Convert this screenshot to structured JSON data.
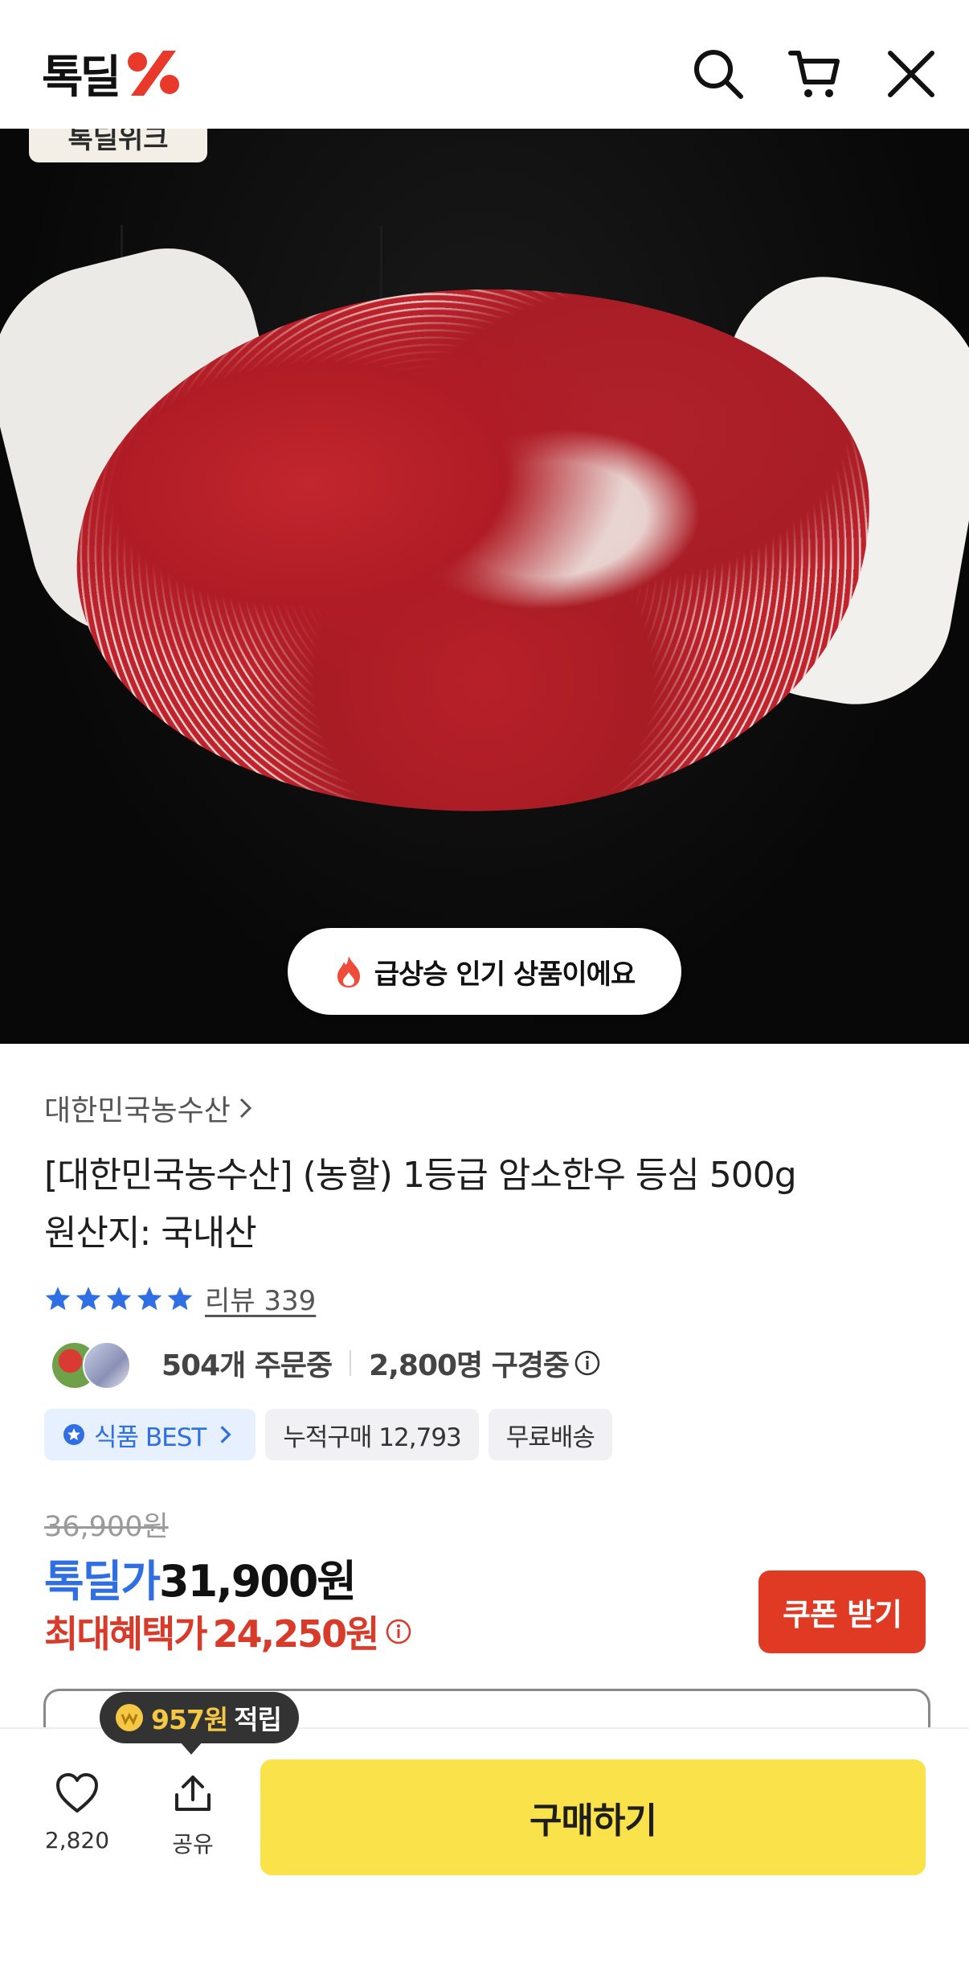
{
  "header": {
    "logo_text": "톡딜",
    "logo_accent_color": "#e8392b",
    "icons": [
      "search-icon",
      "cart-icon",
      "close-icon"
    ]
  },
  "hero": {
    "corner_badge": "톡딜위크",
    "hot_label": "급상승 인기 상품이에요"
  },
  "product": {
    "brand": "대한민국농수산",
    "title_line1": "[대한민국농수산] (농할) 1등급 암소한우 등심 500g",
    "title_line2": "원산지: 국내산",
    "rating_stars": 5,
    "review_link": "리뷰 339",
    "orders_text": "504개 주문중",
    "viewers_text": "2,800명 구경중",
    "tags": [
      "식품 BEST",
      "누적구매 12,793",
      "무료배송"
    ]
  },
  "price": {
    "original": "36,900원",
    "deal_label": "톡딜가",
    "deal_value": "31,900원",
    "max_label": "최대혜택가",
    "max_value": "24,250원",
    "coupon_button": "쿠폰 받기"
  },
  "reward_tooltip": {
    "amount": "957원",
    "word": "적립"
  },
  "bottom_bar": {
    "like_count": "2,820",
    "share_label": "공유",
    "buy_label": "구매하기"
  },
  "colors": {
    "accent_blue": "#2f6fe3",
    "sale_red": "#d83b2a",
    "buy_yellow": "#f9e24a"
  }
}
